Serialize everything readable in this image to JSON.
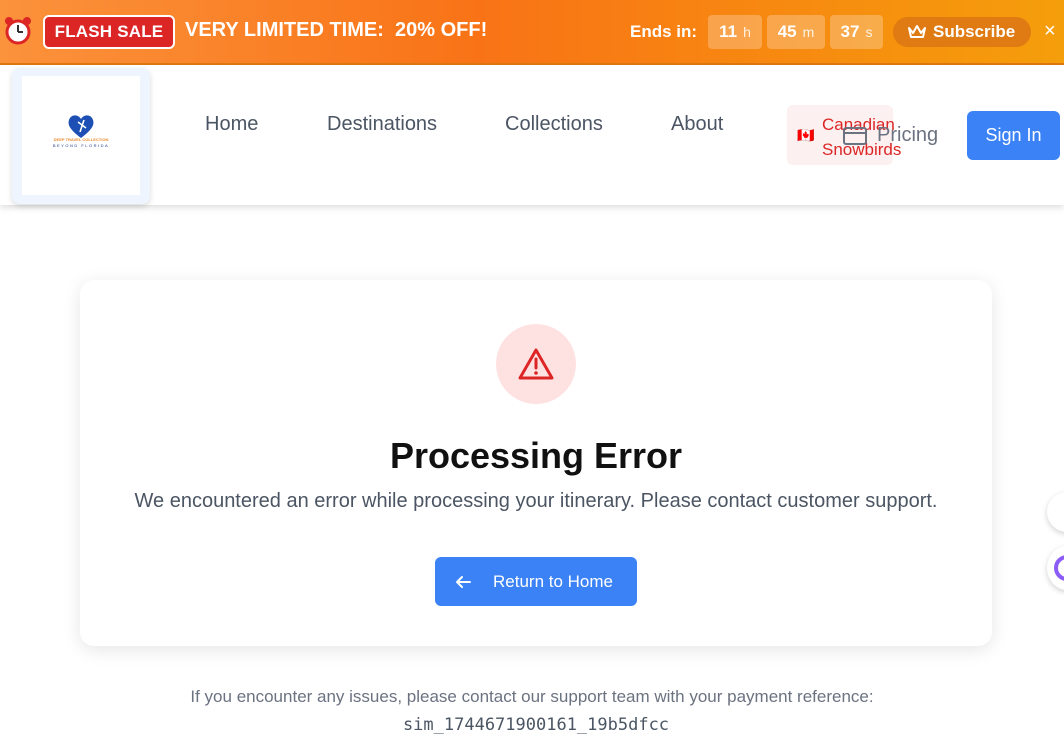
{
  "banner": {
    "clock_icon": "alarm-clock-icon",
    "badge": "FLASH SALE",
    "promo_text": "VERY LIMITED TIME:  20% OFF!",
    "ends_label": "Ends in:",
    "countdown": [
      {
        "value": "11",
        "unit": "h"
      },
      {
        "value": "45",
        "unit": "m"
      },
      {
        "value": "37",
        "unit": "s"
      }
    ],
    "subscribe_label": "Subscribe",
    "close_label": "×",
    "colors": {
      "gradient_start": "#fb923c",
      "gradient_end": "#f59e0b",
      "badge": "#dc2626"
    }
  },
  "header": {
    "logo_text_top": "DEEP TRAVEL COLLECTION",
    "logo_text_bottom": "BEYOND FLORIDA",
    "nav": [
      "Home",
      "Destinations",
      "Collections",
      "About"
    ],
    "snowbirds_flag": "🇨🇦",
    "snowbirds_label": "Canadian Snowbirds",
    "pricing_label": "Pricing",
    "signin_label": "Sign In"
  },
  "error": {
    "icon": "warning-triangle-icon",
    "title": "Processing Error",
    "message": "We encountered an error while processing your itinerary. Please contact customer support.",
    "button_label": "Return to Home"
  },
  "footer": {
    "support_text": "If you encounter any issues, please contact our support team with your payment reference:",
    "reference": "sim_1744671900161_19b5dfcc"
  },
  "colors": {
    "accent": "#3b82f6",
    "error": "#dc2626",
    "error_bg": "#fee2e2"
  }
}
